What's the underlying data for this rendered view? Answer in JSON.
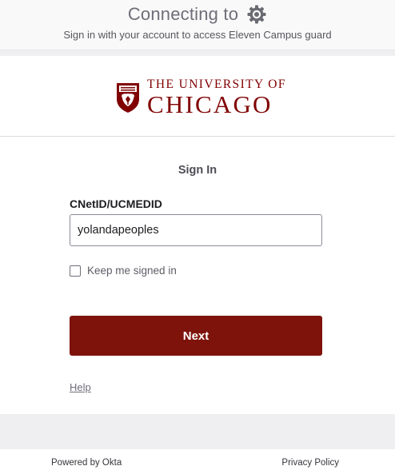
{
  "banner": {
    "title": "Connecting to",
    "app_icon": "gear-icon",
    "subtitle": "Sign in with your account to access Eleven Campus guard"
  },
  "logo": {
    "line1": "THE UNIVERSITY OF",
    "line2": "CHICAGO",
    "crest_icon": "university-crest-icon",
    "color": "#800000"
  },
  "form": {
    "title": "Sign In",
    "username_label": "CNetID/UCMEDID",
    "username_value": "yolandapeoples",
    "remember_label": "Keep me signed in",
    "remember_checked": false,
    "submit_label": "Next",
    "submit_color": "#7e130b",
    "help_label": "Help"
  },
  "footer": {
    "powered_by": "Powered by Okta",
    "privacy_label": "Privacy Policy"
  }
}
